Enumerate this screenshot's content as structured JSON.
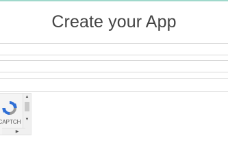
{
  "header": {
    "title": "Create your App"
  },
  "form": {
    "fields": [
      {
        "value": "",
        "placeholder": ""
      },
      {
        "value": "",
        "placeholder": ""
      },
      {
        "value": "",
        "placeholder": ""
      }
    ]
  },
  "captcha": {
    "label": "CAPTCH",
    "logo_icon": "recaptcha-icon"
  },
  "colors": {
    "accent": "#9fd8cb",
    "title_text": "#444444",
    "captcha_blue": "#2f6fd6"
  }
}
